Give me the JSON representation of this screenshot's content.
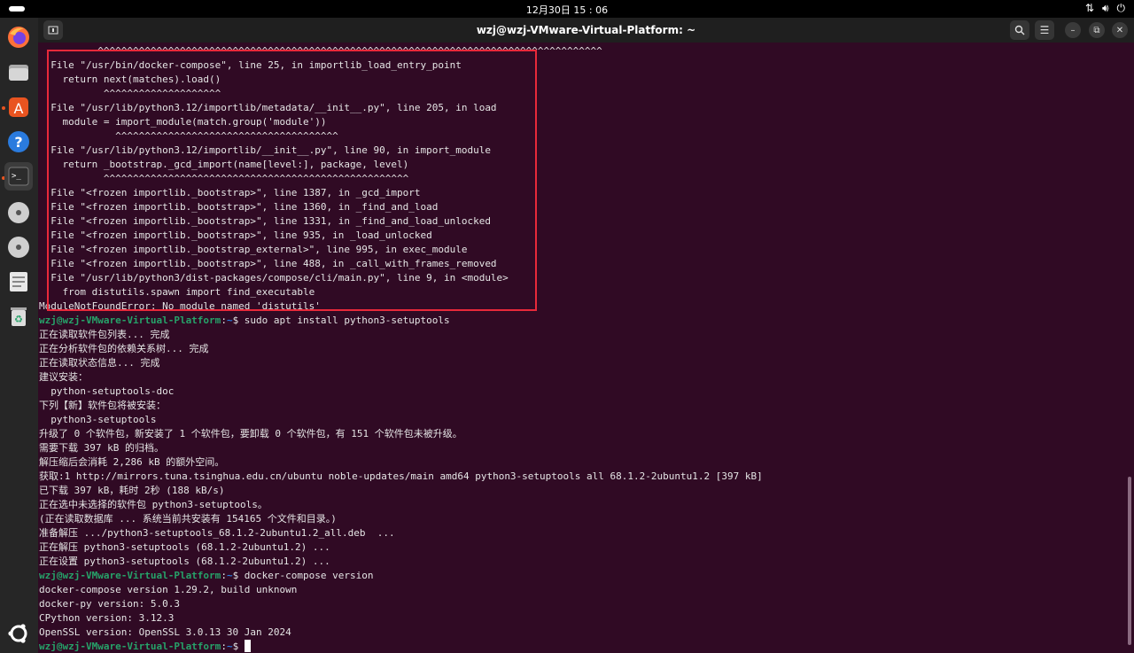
{
  "topbar": {
    "clock": "12月30日  15 : 06",
    "tray_icons": [
      "network-icon",
      "volume-icon",
      "power-icon"
    ]
  },
  "dock": {
    "items": [
      "firefox-icon",
      "files-icon",
      "app-center-icon",
      "help-icon",
      "terminal-icon",
      "disc-icon",
      "disc-icon",
      "text-editor-icon",
      "trash-icon",
      "ubuntu-logo-icon"
    ]
  },
  "window": {
    "title": "wzj@wzj-VMware-Virtual-Platform: ~"
  },
  "terminal": {
    "prompt_user": "wzj@wzj-VMware-Virtual-Platform",
    "prompt_path": "~",
    "lines": [
      {
        "text": "          ^^^^^^^^^^^^^^^^^^^^^^^^^^^^^^^^^^^^^^^^^^^^^^^^^^^^^^^^^^^^^^^^^^^^^^^^^^^^^^^^^^^^^^"
      },
      {
        "text": "  File \"/usr/bin/docker-compose\", line 25, in importlib_load_entry_point"
      },
      {
        "text": "    return next(matches).load()"
      },
      {
        "text": "           ^^^^^^^^^^^^^^^^^^^^"
      },
      {
        "text": "  File \"/usr/lib/python3.12/importlib/metadata/__init__.py\", line 205, in load"
      },
      {
        "text": "    module = import_module(match.group('module'))"
      },
      {
        "text": "             ^^^^^^^^^^^^^^^^^^^^^^^^^^^^^^^^^^^^^^"
      },
      {
        "text": "  File \"/usr/lib/python3.12/importlib/__init__.py\", line 90, in import_module"
      },
      {
        "text": "    return _bootstrap._gcd_import(name[level:], package, level)"
      },
      {
        "text": "           ^^^^^^^^^^^^^^^^^^^^^^^^^^^^^^^^^^^^^^^^^^^^^^^^^^^^"
      },
      {
        "text": "  File \"<frozen importlib._bootstrap>\", line 1387, in _gcd_import"
      },
      {
        "text": "  File \"<frozen importlib._bootstrap>\", line 1360, in _find_and_load"
      },
      {
        "text": "  File \"<frozen importlib._bootstrap>\", line 1331, in _find_and_load_unlocked"
      },
      {
        "text": "  File \"<frozen importlib._bootstrap>\", line 935, in _load_unlocked"
      },
      {
        "text": "  File \"<frozen importlib._bootstrap_external>\", line 995, in exec_module"
      },
      {
        "text": "  File \"<frozen importlib._bootstrap>\", line 488, in _call_with_frames_removed"
      },
      {
        "text": "  File \"/usr/lib/python3/dist-packages/compose/cli/main.py\", line 9, in <module>"
      },
      {
        "text": "    from distutils.spawn import find_executable"
      },
      {
        "text": "ModuleNotFoundError: No module named 'distutils'"
      },
      {
        "prompt": true,
        "text": "$ sudo apt install python3-setuptools"
      },
      {
        "text": "正在读取软件包列表... 完成"
      },
      {
        "text": "正在分析软件包的依赖关系树... 完成"
      },
      {
        "text": "正在读取状态信息... 完成"
      },
      {
        "text": "建议安装："
      },
      {
        "text": "  python-setuptools-doc"
      },
      {
        "text": "下列【新】软件包将被安装："
      },
      {
        "text": "  python3-setuptools"
      },
      {
        "text": "升级了 0 个软件包，新安装了 1 个软件包，要卸载 0 个软件包，有 151 个软件包未被升级。"
      },
      {
        "text": "需要下载 397 kB 的归档。"
      },
      {
        "text": "解压缩后会消耗 2,286 kB 的额外空间。"
      },
      {
        "text": "获取:1 http://mirrors.tuna.tsinghua.edu.cn/ubuntu noble-updates/main amd64 python3-setuptools all 68.1.2-2ubuntu1.2 [397 kB]"
      },
      {
        "text": "已下载 397 kB，耗时 2秒 (188 kB/s)"
      },
      {
        "text": "正在选中未选择的软件包 python3-setuptools。"
      },
      {
        "text": "(正在读取数据库 ... 系统当前共安装有 154165 个文件和目录。)"
      },
      {
        "text": "准备解压 .../python3-setuptools_68.1.2-2ubuntu1.2_all.deb  ..."
      },
      {
        "text": "正在解压 python3-setuptools (68.1.2-2ubuntu1.2) ..."
      },
      {
        "text": "正在设置 python3-setuptools (68.1.2-2ubuntu1.2) ..."
      },
      {
        "prompt": true,
        "text": "$ docker-compose version"
      },
      {
        "text": "docker-compose version 1.29.2, build unknown"
      },
      {
        "text": "docker-py version: 5.0.3"
      },
      {
        "text": "CPython version: 3.12.3"
      },
      {
        "text": "OpenSSL version: OpenSSL 3.0.13 30 Jan 2024"
      },
      {
        "prompt": true,
        "text": "$ ",
        "cursor": true
      }
    ]
  }
}
